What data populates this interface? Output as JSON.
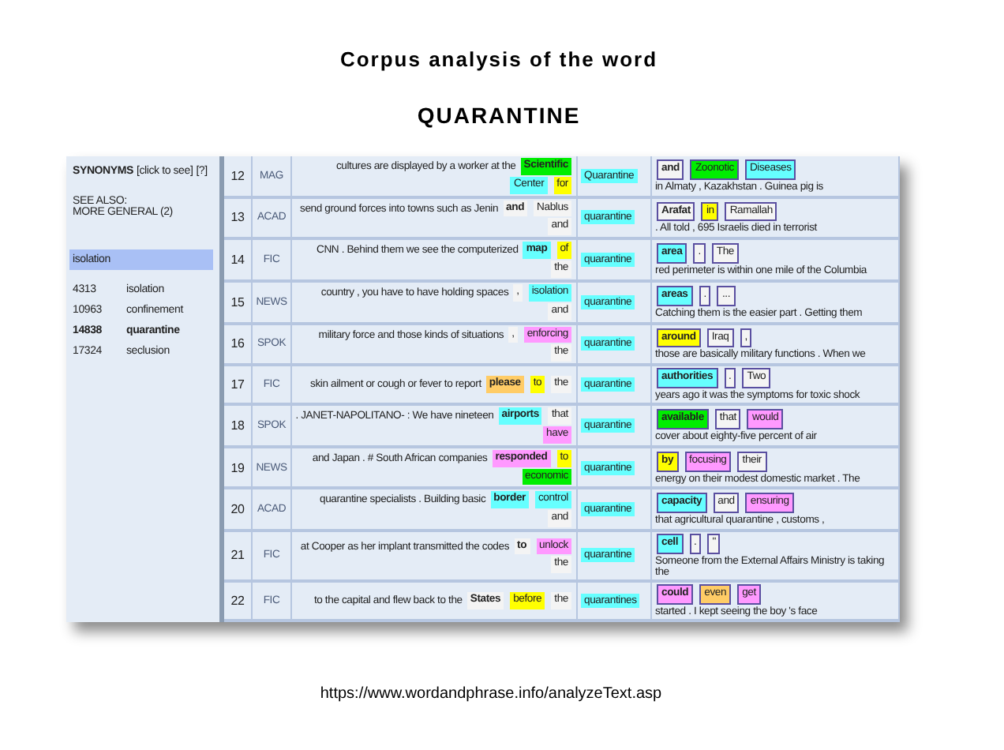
{
  "slide": {
    "title": "Corpus analysis of the word",
    "word": "QUARANTINE",
    "source_url": "https://www.wordandphrase.info/analyzeText.asp"
  },
  "synonyms": {
    "label": "SYNONYMS",
    "click_hint": "[click to see]",
    "help": "[?]",
    "see_also": "SEE ALSO:",
    "more_general": "MORE GENERAL (2)",
    "highlighted": "isolation",
    "items": [
      {
        "count": "4313",
        "word": "isolation",
        "current": false
      },
      {
        "count": "10963",
        "word": "confinement",
        "current": false
      },
      {
        "count": "14838",
        "word": "quarantine",
        "current": true
      },
      {
        "count": "17324",
        "word": "seclusion",
        "current": false
      }
    ]
  },
  "rows": [
    {
      "number": "12",
      "genre": "MAG",
      "node": "Quarantine",
      "left": [
        {
          "kind": "text",
          "text": "cultures are displayed by a worker at the"
        },
        {
          "kind": "word",
          "text": "Scientific",
          "color": "#00ee00",
          "bold": true
        },
        {
          "kind": "word",
          "text": "Center",
          "color": "#66ffff",
          "bold": false
        },
        {
          "kind": "word",
          "text": "for",
          "color": "#ffff00",
          "bold": false
        }
      ],
      "right": [
        {
          "kind": "word",
          "text": "and",
          "color": "#f4f4f4",
          "bold": true
        },
        {
          "kind": "word",
          "text": "Zoonotic",
          "color": "#00ee00",
          "bold": false
        },
        {
          "kind": "word",
          "text": "Diseases",
          "color": "#66ffff",
          "bold": false
        },
        {
          "kind": "text",
          "text": "in Almaty , Kazakhstan . Guinea pig is"
        }
      ]
    },
    {
      "number": "13",
      "genre": "ACAD",
      "node": "quarantine",
      "left": [
        {
          "kind": "text",
          "text": "send ground forces into towns such as Jenin"
        },
        {
          "kind": "word",
          "text": "and",
          "color": "#f4f4f4",
          "bold": true
        },
        {
          "kind": "word",
          "text": "Nablus",
          "color": "#f4f4f4",
          "bold": false
        },
        {
          "kind": "word",
          "text": "and",
          "color": "#f4f4f4",
          "bold": false
        }
      ],
      "right": [
        {
          "kind": "word",
          "text": "Arafat",
          "color": "#f4f4f4",
          "bold": true
        },
        {
          "kind": "word",
          "text": "in",
          "color": "#ffff00",
          "bold": false
        },
        {
          "kind": "word",
          "text": "Ramallah",
          "color": "#f4f4f4",
          "bold": false
        },
        {
          "kind": "text",
          "text": ". All told , 695 Israelis died in terrorist"
        }
      ]
    },
    {
      "number": "14",
      "genre": "FIC",
      "node": "quarantine",
      "left": [
        {
          "kind": "text",
          "text": "CNN . Behind them we see the computerized"
        },
        {
          "kind": "word",
          "text": "map",
          "color": "#66ffff",
          "bold": true
        },
        {
          "kind": "word",
          "text": "of",
          "color": "#ffff00",
          "bold": false
        },
        {
          "kind": "word",
          "text": "the",
          "color": "#f4f4f4",
          "bold": false
        }
      ],
      "right": [
        {
          "kind": "word",
          "text": "area",
          "color": "#66ffff",
          "bold": true
        },
        {
          "kind": "word",
          "text": ".",
          "color": "#f4f4f4",
          "bold": false
        },
        {
          "kind": "word",
          "text": "The",
          "color": "#f4f4f4",
          "bold": false
        },
        {
          "kind": "text",
          "text": "red perimeter is within one mile of the Columbia"
        }
      ]
    },
    {
      "number": "15",
      "genre": "NEWS",
      "node": "quarantine",
      "left": [
        {
          "kind": "text",
          "text": "country , you have to have holding spaces"
        },
        {
          "kind": "word",
          "text": ",",
          "color": "#f4f4f4",
          "bold": false
        },
        {
          "kind": "word",
          "text": "isolation",
          "color": "#66ffff",
          "bold": false
        },
        {
          "kind": "word",
          "text": "and",
          "color": "#f4f4f4",
          "bold": false
        }
      ],
      "right": [
        {
          "kind": "word",
          "text": "areas",
          "color": "#66ffff",
          "bold": true
        },
        {
          "kind": "word",
          "text": ".",
          "color": "#f4f4f4",
          "bold": false
        },
        {
          "kind": "word",
          "text": "...",
          "color": "#f4f4f4",
          "bold": false
        },
        {
          "kind": "text",
          "text": "Catching them is the easier part . Getting them"
        }
      ]
    },
    {
      "number": "16",
      "genre": "SPOK",
      "node": "quarantine",
      "left": [
        {
          "kind": "text",
          "text": "military force and those kinds of situations"
        },
        {
          "kind": "word",
          "text": ",",
          "color": "#f4f4f4",
          "bold": false
        },
        {
          "kind": "word",
          "text": "enforcing",
          "color": "#ff99ff",
          "bold": false
        },
        {
          "kind": "word",
          "text": "the",
          "color": "#f4f4f4",
          "bold": false
        }
      ],
      "right": [
        {
          "kind": "word",
          "text": "around",
          "color": "#ffff00",
          "bold": true
        },
        {
          "kind": "word",
          "text": "Iraq",
          "color": "#f4f4f4",
          "bold": false
        },
        {
          "kind": "word",
          "text": ",",
          "color": "#f4f4f4",
          "bold": false
        },
        {
          "kind": "text",
          "text": "those are basically military functions . When we"
        }
      ]
    },
    {
      "number": "17",
      "genre": "FIC",
      "node": "quarantine",
      "left": [
        {
          "kind": "text",
          "text": "skin ailment or cough or fever to report"
        },
        {
          "kind": "word",
          "text": "please",
          "color": "#ffcc66",
          "bold": true
        },
        {
          "kind": "word",
          "text": "to",
          "color": "#ffff00",
          "bold": false
        },
        {
          "kind": "word",
          "text": "the",
          "color": "#f4f4f4",
          "bold": false
        }
      ],
      "right": [
        {
          "kind": "word",
          "text": "authorities",
          "color": "#66ffff",
          "bold": true
        },
        {
          "kind": "word",
          "text": ".",
          "color": "#f4f4f4",
          "bold": false
        },
        {
          "kind": "word",
          "text": "Two",
          "color": "#f4f4f4",
          "bold": false
        },
        {
          "kind": "text",
          "text": "years ago it was the symptoms for toxic shock"
        }
      ]
    },
    {
      "number": "18",
      "genre": "SPOK",
      "node": "quarantine",
      "left": [
        {
          "kind": "text",
          "text": ". JANET-NAPOLITANO- : We have nineteen"
        },
        {
          "kind": "word",
          "text": "airports",
          "color": "#66ffff",
          "bold": true
        },
        {
          "kind": "word",
          "text": "that",
          "color": "#f4f4f4",
          "bold": false
        },
        {
          "kind": "word",
          "text": "have",
          "color": "#ff99ff",
          "bold": false
        }
      ],
      "right": [
        {
          "kind": "word",
          "text": "available",
          "color": "#00ee00",
          "bold": true
        },
        {
          "kind": "word",
          "text": "that",
          "color": "#f4f4f4",
          "bold": false
        },
        {
          "kind": "word",
          "text": "would",
          "color": "#ff99ff",
          "bold": false
        },
        {
          "kind": "text",
          "text": "cover about eighty-five percent of air"
        }
      ]
    },
    {
      "number": "19",
      "genre": "NEWS",
      "node": "quarantine",
      "left": [
        {
          "kind": "text",
          "text": "and Japan . # South African companies"
        },
        {
          "kind": "word",
          "text": "responded",
          "color": "#ff99ff",
          "bold": true
        },
        {
          "kind": "word",
          "text": "to",
          "color": "#ffff00",
          "bold": false
        },
        {
          "kind": "word",
          "text": "economic",
          "color": "#00ee00",
          "bold": false
        }
      ],
      "right": [
        {
          "kind": "word",
          "text": "by",
          "color": "#ffff00",
          "bold": true
        },
        {
          "kind": "word",
          "text": "focusing",
          "color": "#ff99ff",
          "bold": false
        },
        {
          "kind": "word",
          "text": "their",
          "color": "#f4f4f4",
          "bold": false
        },
        {
          "kind": "text",
          "text": "energy on their modest domestic market . The"
        }
      ]
    },
    {
      "number": "20",
      "genre": "ACAD",
      "node": "quarantine",
      "left": [
        {
          "kind": "text",
          "text": "quarantine specialists . Building basic"
        },
        {
          "kind": "word",
          "text": "border",
          "color": "#66ffff",
          "bold": true
        },
        {
          "kind": "word",
          "text": "control",
          "color": "#66ffff",
          "bold": false
        },
        {
          "kind": "word",
          "text": "and",
          "color": "#f4f4f4",
          "bold": false
        }
      ],
      "right": [
        {
          "kind": "word",
          "text": "capacity",
          "color": "#66ffff",
          "bold": true
        },
        {
          "kind": "word",
          "text": "and",
          "color": "#f4f4f4",
          "bold": false
        },
        {
          "kind": "word",
          "text": "ensuring",
          "color": "#ff99ff",
          "bold": false
        },
        {
          "kind": "text",
          "text": "that agricultural quarantine , customs ,"
        }
      ]
    },
    {
      "number": "21",
      "genre": "FIC",
      "node": "quarantine",
      "left": [
        {
          "kind": "text",
          "text": "at Cooper as her implant transmitted the codes"
        },
        {
          "kind": "word",
          "text": "to",
          "color": "#f4f4f4",
          "bold": true
        },
        {
          "kind": "word",
          "text": "unlock",
          "color": "#ff99ff",
          "bold": false
        },
        {
          "kind": "word",
          "text": "the",
          "color": "#f4f4f4",
          "bold": false
        }
      ],
      "right": [
        {
          "kind": "word",
          "text": "cell",
          "color": "#66ffff",
          "bold": true
        },
        {
          "kind": "word",
          "text": ".",
          "color": "#f4f4f4",
          "bold": false
        },
        {
          "kind": "word",
          "text": "\"",
          "color": "#f4f4f4",
          "bold": false
        },
        {
          "kind": "text",
          "text": "Someone from the External Affairs Ministry is taking the"
        }
      ]
    },
    {
      "number": "22",
      "genre": "FIC",
      "node": "quarantines",
      "left": [
        {
          "kind": "text",
          "text": "to the capital and flew back to the"
        },
        {
          "kind": "word",
          "text": "States",
          "color": "#f4f4f4",
          "bold": true
        },
        {
          "kind": "word",
          "text": "before",
          "color": "#ffff00",
          "bold": false
        },
        {
          "kind": "word",
          "text": "the",
          "color": "#f4f4f4",
          "bold": false
        }
      ],
      "right": [
        {
          "kind": "word",
          "text": "could",
          "color": "#ff99ff",
          "bold": true
        },
        {
          "kind": "word",
          "text": "even",
          "color": "#ffcc66",
          "bold": false
        },
        {
          "kind": "word",
          "text": "get",
          "color": "#ff99ff",
          "bold": false
        },
        {
          "kind": "text",
          "text": "started . I kept seeing the boy 's face"
        }
      ]
    }
  ]
}
